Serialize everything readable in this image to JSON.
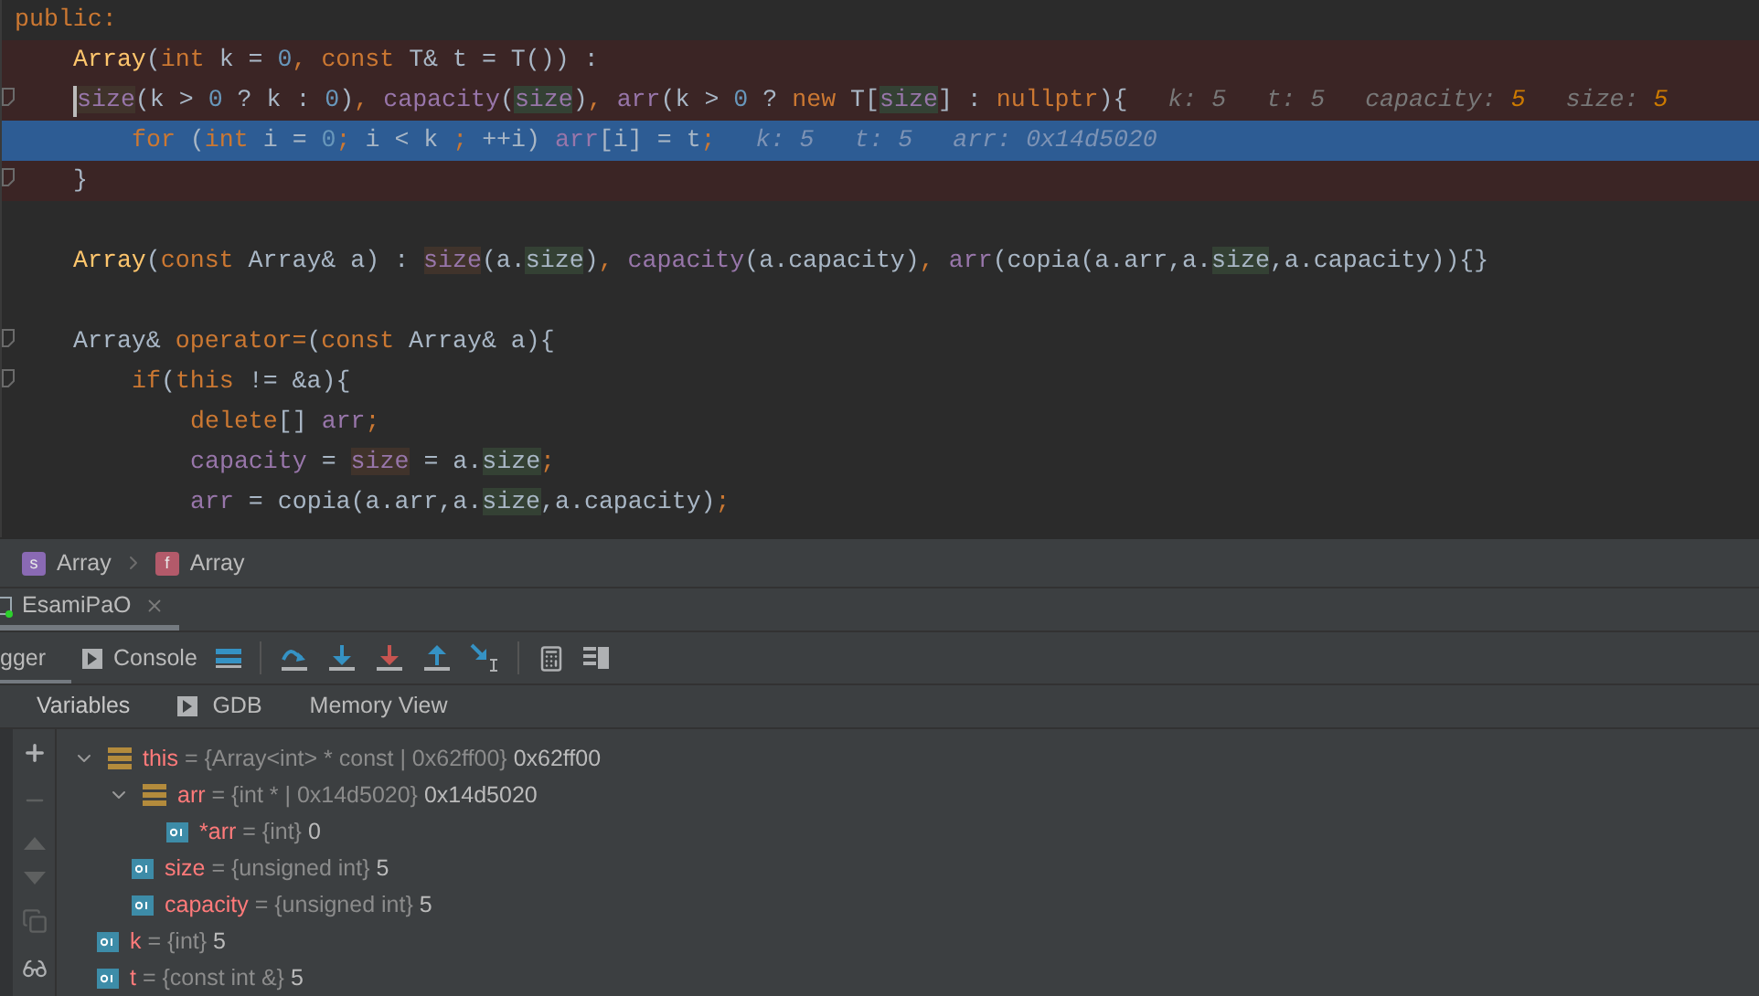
{
  "editor": {
    "lines": [
      {
        "kind": "code",
        "tokens": [
          {
            "text": "public:",
            "kind": "kw"
          }
        ],
        "children": [
          {
            "kind": "code",
            "breakpoint": true,
            "tokens": [
              {
                "text": "Array",
                "kind": "fn"
              },
              {
                "text": "(",
                "kind": "p"
              },
              {
                "text": "int",
                "kind": "kw"
              },
              {
                "text": " k = ",
                "kind": "p"
              },
              {
                "text": "0",
                "kind": "num"
              },
              {
                "text": ", const",
                "kind": "kw"
              },
              {
                "text": " T& t = T()) :",
                "kind": "p"
              }
            ]
          },
          {
            "kind": "code",
            "breakpoint": true,
            "caret": true,
            "fold": true,
            "tokens": [
              {
                "text": "size",
                "kind": "field",
                "write": true
              },
              {
                "text": "(k > ",
                "kind": "p"
              },
              {
                "text": "0",
                "kind": "num"
              },
              {
                "text": " ? k : ",
                "kind": "p"
              },
              {
                "text": "0",
                "kind": "num"
              },
              {
                "text": ")",
                "kind": "p"
              },
              {
                "text": ", ",
                "kind": "kw"
              },
              {
                "text": "capacity",
                "kind": "field"
              },
              {
                "text": "(",
                "kind": "p"
              },
              {
                "text": "size",
                "kind": "field",
                "read": true
              },
              {
                "text": ")",
                "kind": "p"
              },
              {
                "text": ", ",
                "kind": "kw"
              },
              {
                "text": "arr",
                "kind": "field"
              },
              {
                "text": "(k > ",
                "kind": "p"
              },
              {
                "text": "0",
                "kind": "num"
              },
              {
                "text": " ? ",
                "kind": "p"
              },
              {
                "text": "new",
                "kind": "kw"
              },
              {
                "text": " T[",
                "kind": "p"
              },
              {
                "text": "size",
                "kind": "field",
                "read": true
              },
              {
                "text": "] : ",
                "kind": "p"
              },
              {
                "text": "nullptr",
                "kind": "kw"
              },
              {
                "text": "){",
                "kind": "p"
              }
            ],
            "hints": [
              {
                "label": "k:",
                "value": "5",
                "changed": false
              },
              {
                "label": "t:",
                "value": "5",
                "changed": false
              },
              {
                "label": "capacity:",
                "value": "5",
                "changed": true
              },
              {
                "label": "size:",
                "value": "5",
                "changed": true
              }
            ],
            "children": [
              {
                "kind": "code",
                "current": true,
                "tokens": [
                  {
                    "text": "for",
                    "kind": "kw"
                  },
                  {
                    "text": " (",
                    "kind": "p"
                  },
                  {
                    "text": "int",
                    "kind": "kw"
                  },
                  {
                    "text": " i = ",
                    "kind": "p"
                  },
                  {
                    "text": "0",
                    "kind": "num"
                  },
                  {
                    "text": ";",
                    "kind": "kw"
                  },
                  {
                    "text": " i < k ",
                    "kind": "p"
                  },
                  {
                    "text": ";",
                    "kind": "kw"
                  },
                  {
                    "text": " ++i) ",
                    "kind": "p"
                  },
                  {
                    "text": "arr",
                    "kind": "field"
                  },
                  {
                    "text": "[i] = t",
                    "kind": "p"
                  },
                  {
                    "text": ";",
                    "kind": "kw"
                  }
                ],
                "hints": [
                  {
                    "label": "k:",
                    "value": "5",
                    "changed": false
                  },
                  {
                    "label": "t:",
                    "value": "5",
                    "changed": false
                  },
                  {
                    "label": "arr:",
                    "value": "0x14d5020",
                    "changed": false
                  }
                ]
              }
            ]
          },
          {
            "kind": "code",
            "breakpoint": true,
            "fold": true,
            "tokens": [
              {
                "text": "}",
                "kind": "p"
              }
            ]
          },
          {
            "kind": "blank"
          },
          {
            "kind": "code",
            "tokens": [
              {
                "text": "Array",
                "kind": "fn"
              },
              {
                "text": "(",
                "kind": "p"
              },
              {
                "text": "const",
                "kind": "kw"
              },
              {
                "text": " Array& a) : ",
                "kind": "p"
              },
              {
                "text": "size",
                "kind": "field",
                "write": true
              },
              {
                "text": "(a.",
                "kind": "p"
              },
              {
                "text": "size",
                "kind": "p",
                "read": true
              },
              {
                "text": ")",
                "kind": "p"
              },
              {
                "text": ", ",
                "kind": "kw"
              },
              {
                "text": "capacity",
                "kind": "field"
              },
              {
                "text": "(a.capacity)",
                "kind": "p"
              },
              {
                "text": ", ",
                "kind": "kw"
              },
              {
                "text": "arr",
                "kind": "field"
              },
              {
                "text": "(copia(a.arr,a.",
                "kind": "p"
              },
              {
                "text": "size",
                "kind": "p",
                "read": true
              },
              {
                "text": ",a.capacity)){}",
                "kind": "p"
              }
            ]
          },
          {
            "kind": "blank"
          },
          {
            "kind": "code",
            "fold": true,
            "tokens": [
              {
                "text": "Array& ",
                "kind": "p"
              },
              {
                "text": "operator=",
                "kind": "kw"
              },
              {
                "text": "(",
                "kind": "p"
              },
              {
                "text": "const",
                "kind": "kw"
              },
              {
                "text": " Array& a){",
                "kind": "p"
              }
            ],
            "children": [
              {
                "kind": "code",
                "fold": true,
                "tokens": [
                  {
                    "text": "if",
                    "kind": "kw"
                  },
                  {
                    "text": "(",
                    "kind": "p"
                  },
                  {
                    "text": "this",
                    "kind": "kw"
                  },
                  {
                    "text": " != &a){",
                    "kind": "p"
                  }
                ],
                "children": [
                  {
                    "kind": "code",
                    "tokens": [
                      {
                        "text": "delete",
                        "kind": "kw"
                      },
                      {
                        "text": "[] ",
                        "kind": "p"
                      },
                      {
                        "text": "arr",
                        "kind": "field"
                      },
                      {
                        "text": ";",
                        "kind": "kw"
                      }
                    ]
                  },
                  {
                    "kind": "code",
                    "tokens": [
                      {
                        "text": "capacity",
                        "kind": "field"
                      },
                      {
                        "text": " = ",
                        "kind": "p"
                      },
                      {
                        "text": "size",
                        "kind": "field",
                        "write": true
                      },
                      {
                        "text": " = a.",
                        "kind": "p"
                      },
                      {
                        "text": "size",
                        "kind": "p",
                        "read": true
                      },
                      {
                        "text": ";",
                        "kind": "kw"
                      }
                    ]
                  },
                  {
                    "kind": "code",
                    "tokens": [
                      {
                        "text": "arr",
                        "kind": "field"
                      },
                      {
                        "text": " = copia(a.arr,a.",
                        "kind": "p"
                      },
                      {
                        "text": "size",
                        "kind": "p",
                        "read": true
                      },
                      {
                        "text": ",a.capacity)",
                        "kind": "p"
                      },
                      {
                        "text": ";",
                        "kind": "kw"
                      }
                    ]
                  }
                ]
              }
            ]
          }
        ]
      }
    ]
  },
  "breadcrumbs": [
    {
      "kind": "struct",
      "badge": "s",
      "label": "Array"
    },
    {
      "kind": "function",
      "badge": "f",
      "label": "Array"
    }
  ],
  "debug_window": {
    "session_tabs": [
      {
        "label": "EsamiPaO",
        "selected": true
      }
    ],
    "tool_tabs": [
      {
        "label": "gger",
        "selected": true,
        "icon": false
      },
      {
        "label": "Console",
        "selected": false,
        "icon": true
      }
    ],
    "subtabs": [
      {
        "label": "Variables",
        "selected": true,
        "icon": false
      },
      {
        "label": "GDB",
        "selected": false,
        "icon": true
      },
      {
        "label": "Memory View",
        "selected": false,
        "icon": false
      }
    ],
    "variables": [
      {
        "kind": "object",
        "name": "this",
        "detail": "= {Array<int> * const | 0x62ff00}",
        "value": "0x62ff00",
        "expanded": true,
        "children": [
          {
            "kind": "object",
            "name": "arr",
            "detail": "= {int * | 0x14d5020}",
            "value": "0x14d5020",
            "expanded": true,
            "children": [
              {
                "kind": "primitive",
                "name": "*arr",
                "detail": "= {int}",
                "value": "0"
              }
            ]
          },
          {
            "kind": "primitive",
            "name": "size",
            "detail": "= {unsigned int}",
            "value": "5"
          },
          {
            "kind": "primitive",
            "name": "capacity",
            "detail": "= {unsigned int}",
            "value": "5"
          }
        ]
      },
      {
        "kind": "primitive",
        "name": "k",
        "detail": "= {int}",
        "value": "5"
      },
      {
        "kind": "primitive",
        "name": "t",
        "detail": "= {const int &}",
        "value": "5"
      }
    ]
  }
}
